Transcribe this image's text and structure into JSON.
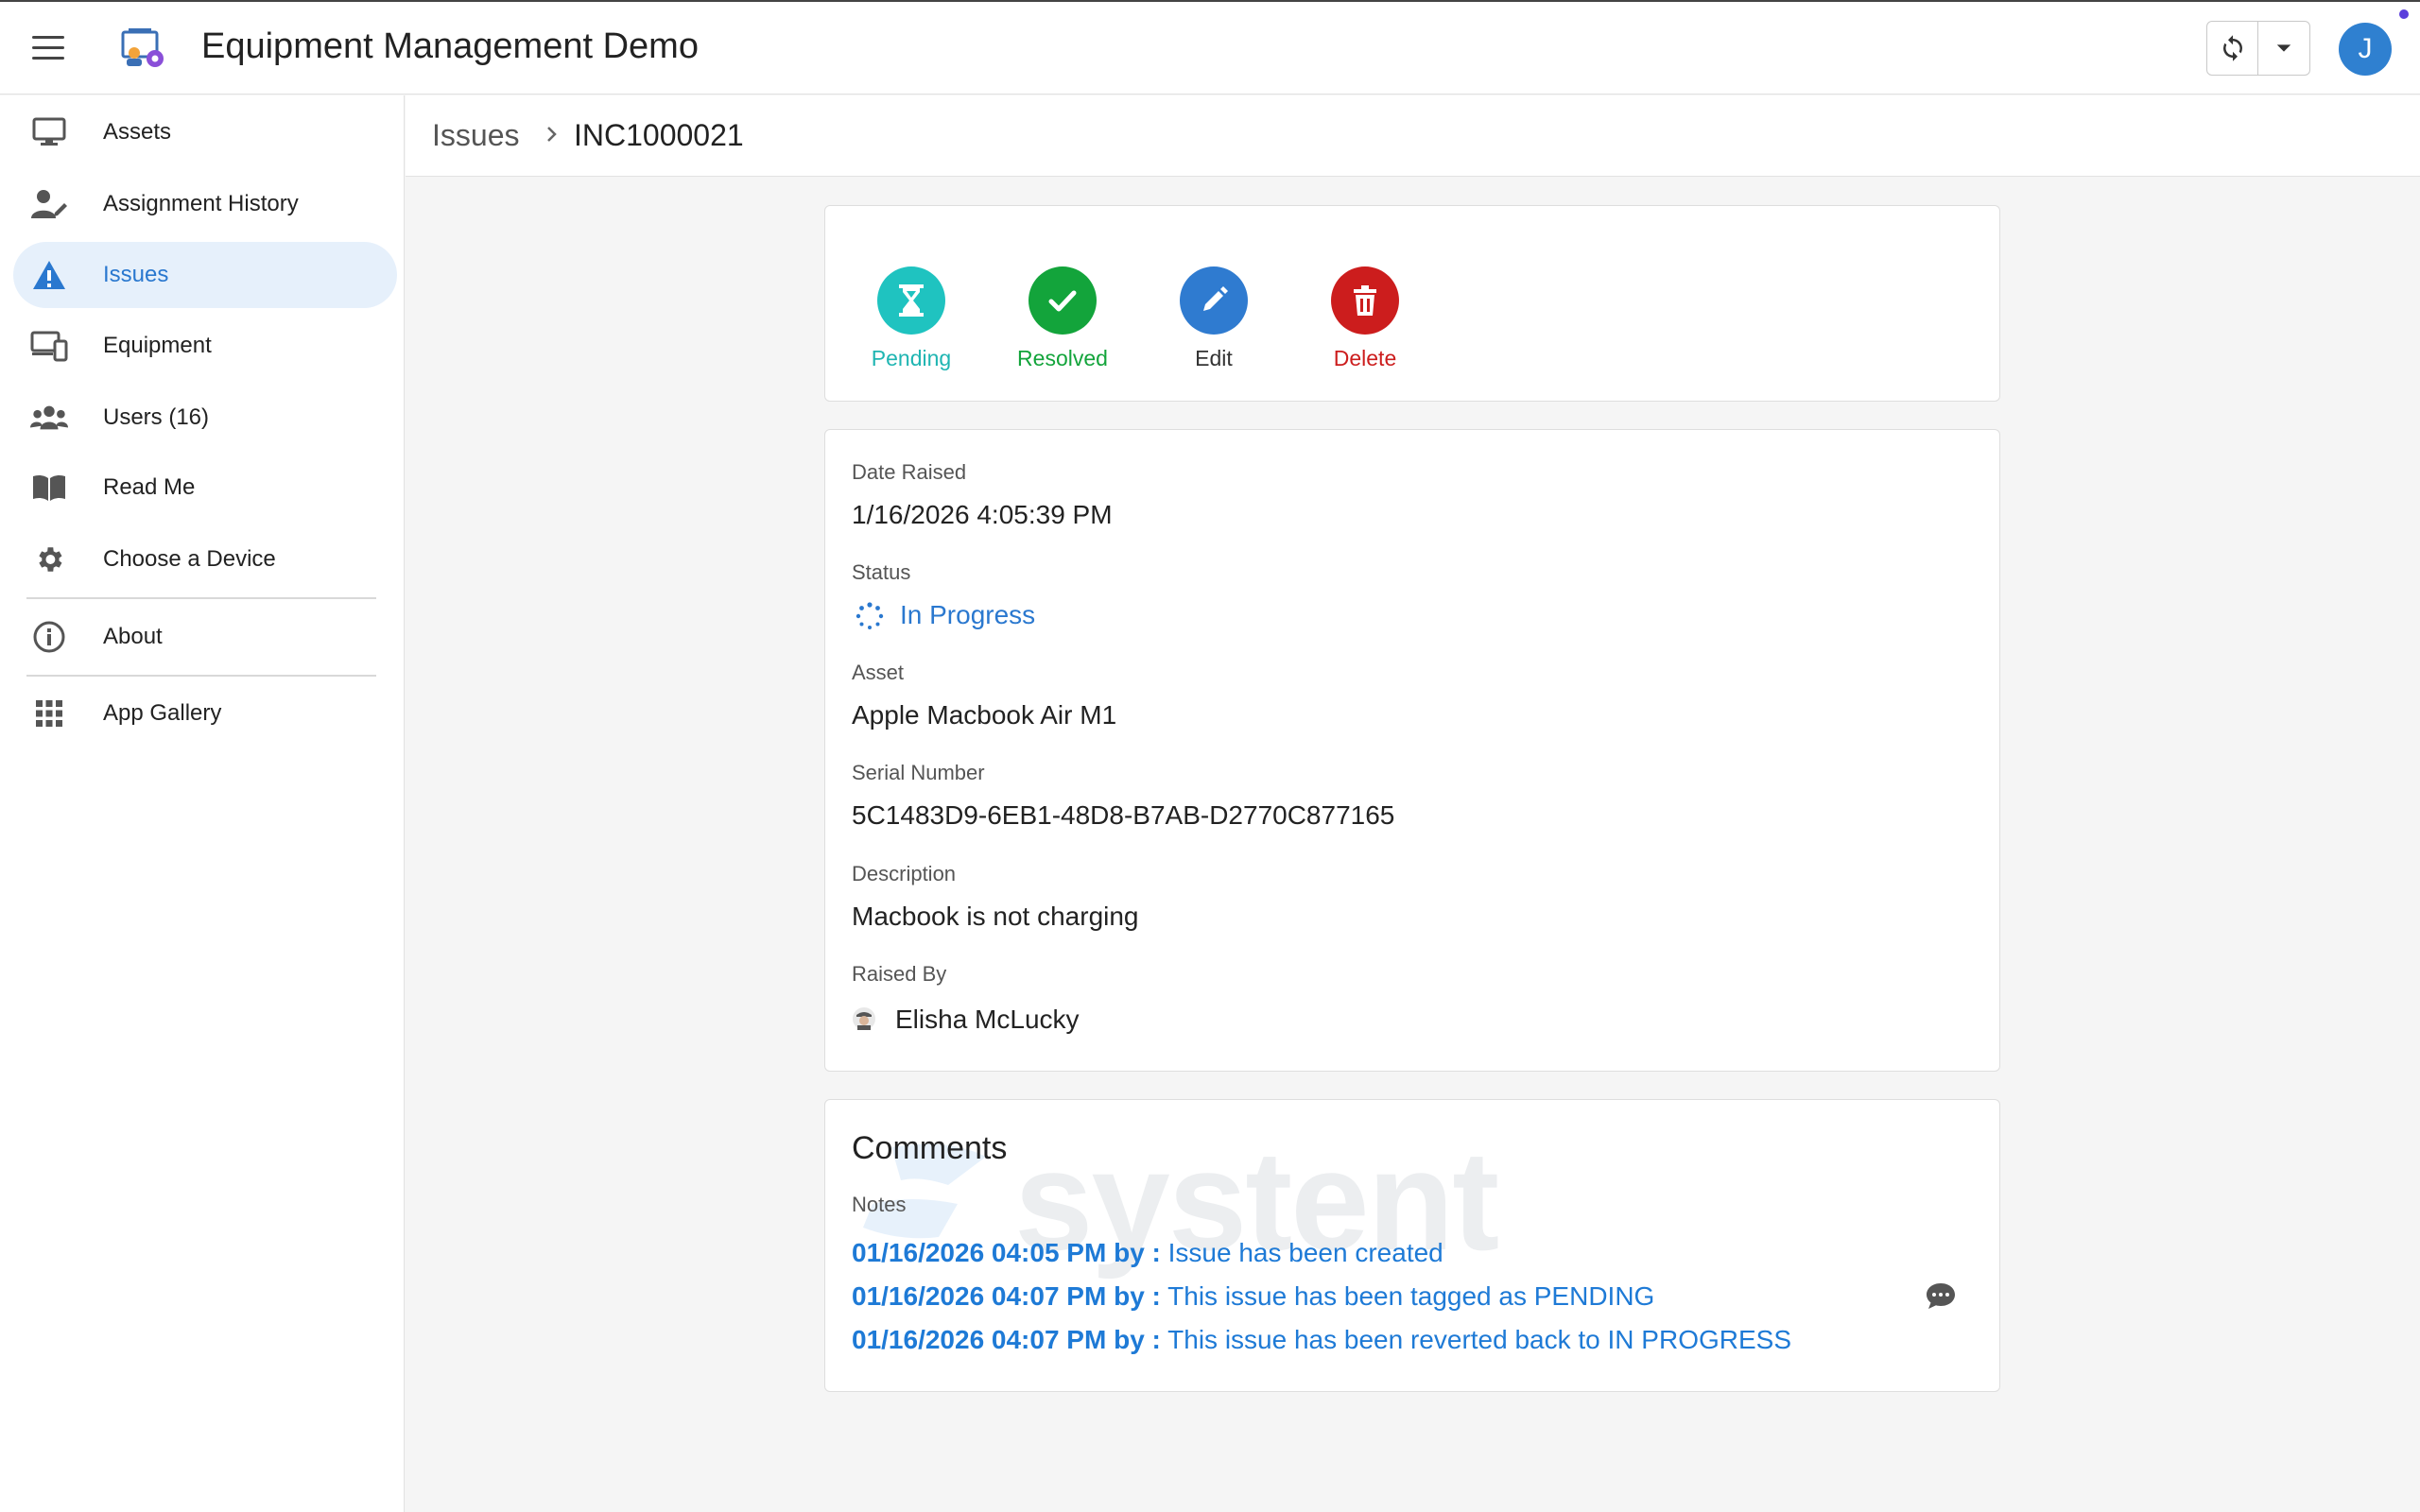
{
  "app": {
    "title": "Equipment Management Demo",
    "user_initial": "J"
  },
  "sidebar": {
    "items": [
      {
        "label": "Assets",
        "icon": "monitor-icon"
      },
      {
        "label": "Assignment History",
        "icon": "user-edit-icon"
      },
      {
        "label": "Issues",
        "icon": "warning-icon",
        "active": true
      },
      {
        "label": "Equipment",
        "icon": "devices-icon"
      },
      {
        "label": "Users (16)",
        "icon": "users-icon"
      },
      {
        "label": "Read Me",
        "icon": "book-icon"
      },
      {
        "label": "Choose a Device",
        "icon": "gear-icon"
      },
      {
        "label": "About",
        "icon": "info-icon"
      },
      {
        "label": "App Gallery",
        "icon": "grid-icon"
      }
    ]
  },
  "breadcrumb": {
    "parent": "Issues",
    "current": "INC1000021"
  },
  "actions": {
    "pending": "Pending",
    "resolved": "Resolved",
    "edit": "Edit",
    "delete": "Delete"
  },
  "details": {
    "date_raised_label": "Date Raised",
    "date_raised": "1/16/2026 4:05:39 PM",
    "status_label": "Status",
    "status": "In Progress",
    "asset_label": "Asset",
    "asset": "Apple Macbook Air M1",
    "serial_label": "Serial Number",
    "serial": "5C1483D9-6EB1-48D8-B7AB-D2770C877165",
    "description_label": "Description",
    "description": "Macbook is not charging",
    "raised_by_label": "Raised By",
    "raised_by": "Elisha McLucky"
  },
  "comments": {
    "title": "Comments",
    "notes_label": "Notes",
    "watermark": "systent",
    "notes": [
      {
        "prefix": "01/16/2026 04:05 PM by :",
        "text": "Issue has been created"
      },
      {
        "prefix": "01/16/2026 04:07 PM by :",
        "text": "This issue has been tagged as PENDING"
      },
      {
        "prefix": "01/16/2026 04:07 PM by :",
        "text": "This issue has been reverted back to IN PROGRESS"
      }
    ]
  },
  "colors": {
    "accent": "#2a78cf",
    "pending": "#1fc3c0",
    "resolved": "#13a43b",
    "edit": "#2f7bd0",
    "delete": "#cc1d1d",
    "note_text": "#1e7ad6"
  }
}
